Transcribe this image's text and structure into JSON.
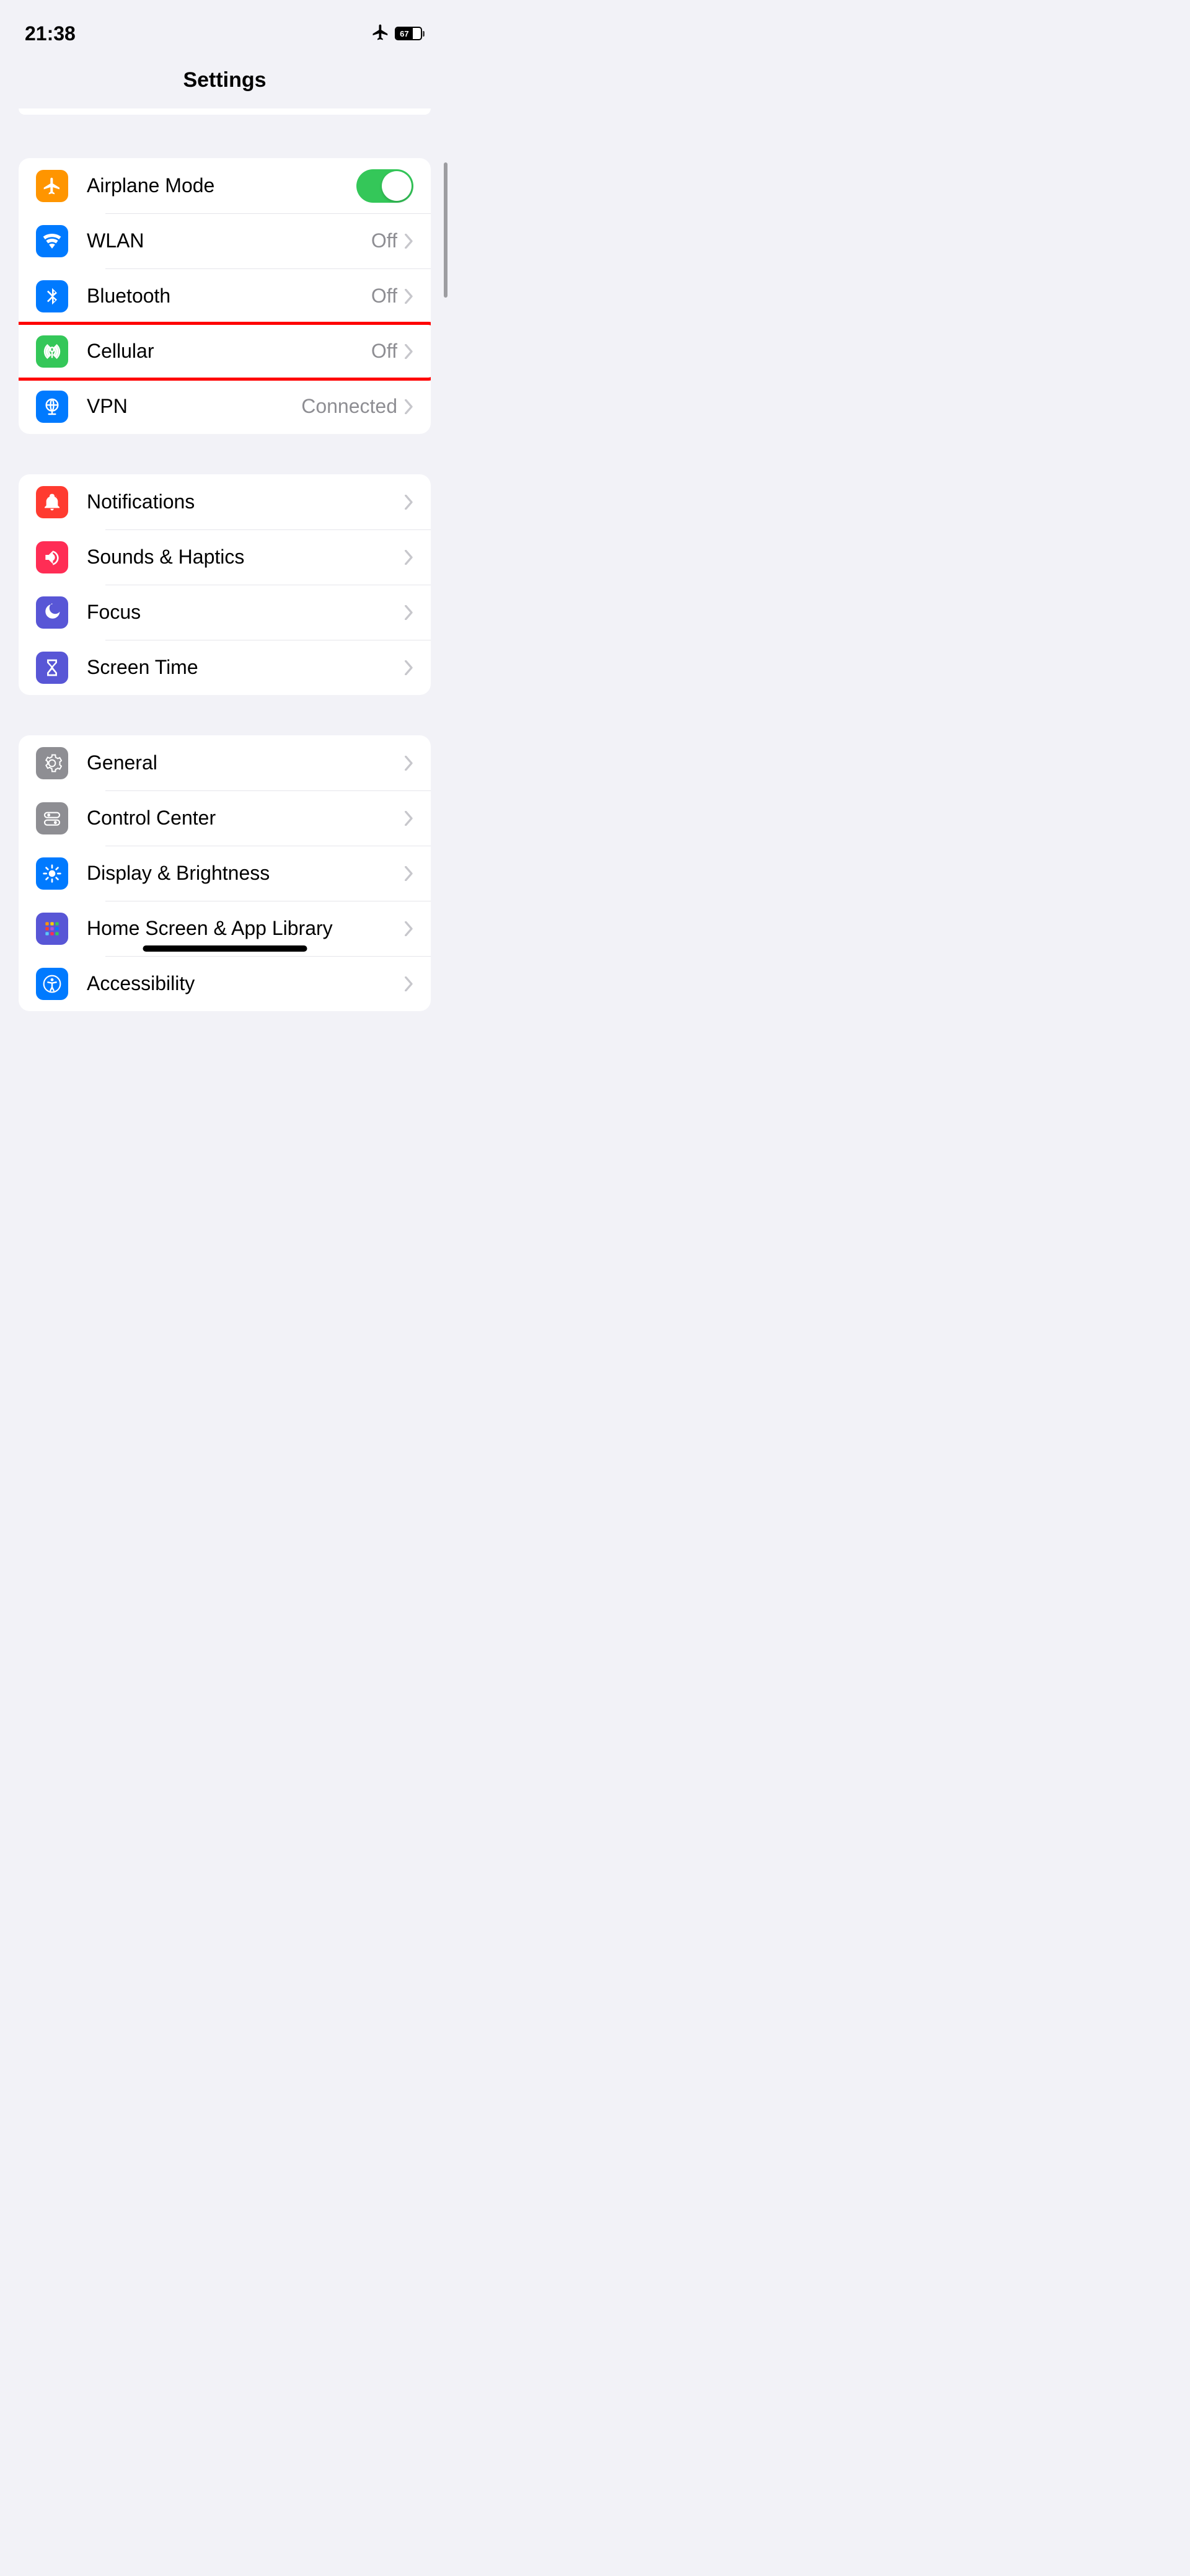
{
  "status": {
    "time": "21:38",
    "battery": "67"
  },
  "header": {
    "title": "Settings"
  },
  "groups": [
    {
      "id": "connectivity",
      "rows": [
        {
          "id": "airplane-mode",
          "label": "Airplane Mode",
          "icon": "airplane",
          "iconColor": "ic-orange",
          "type": "toggle",
          "toggled": true
        },
        {
          "id": "wlan",
          "label": "WLAN",
          "value": "Off",
          "icon": "wifi",
          "iconColor": "ic-blue",
          "type": "nav"
        },
        {
          "id": "bluetooth",
          "label": "Bluetooth",
          "value": "Off",
          "icon": "bluetooth",
          "iconColor": "ic-blue",
          "type": "nav"
        },
        {
          "id": "cellular",
          "label": "Cellular",
          "value": "Off",
          "icon": "cellular",
          "iconColor": "ic-green",
          "type": "nav",
          "highlighted": true
        },
        {
          "id": "vpn",
          "label": "VPN",
          "value": "Connected",
          "icon": "vpn",
          "iconColor": "ic-blue",
          "type": "nav"
        }
      ]
    },
    {
      "id": "notifications-group",
      "rows": [
        {
          "id": "notifications",
          "label": "Notifications",
          "icon": "bell",
          "iconColor": "ic-red",
          "type": "nav"
        },
        {
          "id": "sounds-haptics",
          "label": "Sounds & Haptics",
          "icon": "speaker",
          "iconColor": "ic-pink",
          "type": "nav"
        },
        {
          "id": "focus",
          "label": "Focus",
          "icon": "moon",
          "iconColor": "ic-indigo",
          "type": "nav"
        },
        {
          "id": "screen-time",
          "label": "Screen Time",
          "icon": "hourglass",
          "iconColor": "ic-indigo",
          "type": "nav"
        }
      ]
    },
    {
      "id": "general-group",
      "rows": [
        {
          "id": "general",
          "label": "General",
          "icon": "gear",
          "iconColor": "ic-gray",
          "type": "nav"
        },
        {
          "id": "control-center",
          "label": "Control Center",
          "icon": "switches",
          "iconColor": "ic-gray",
          "type": "nav"
        },
        {
          "id": "display-brightness",
          "label": "Display & Brightness",
          "icon": "sun",
          "iconColor": "ic-blue",
          "type": "nav"
        },
        {
          "id": "home-screen",
          "label": "Home Screen & App Library",
          "icon": "grid",
          "iconColor": "ic-indigo",
          "type": "nav"
        },
        {
          "id": "accessibility",
          "label": "Accessibility",
          "icon": "accessibility",
          "iconColor": "ic-blue",
          "type": "nav"
        }
      ]
    }
  ]
}
